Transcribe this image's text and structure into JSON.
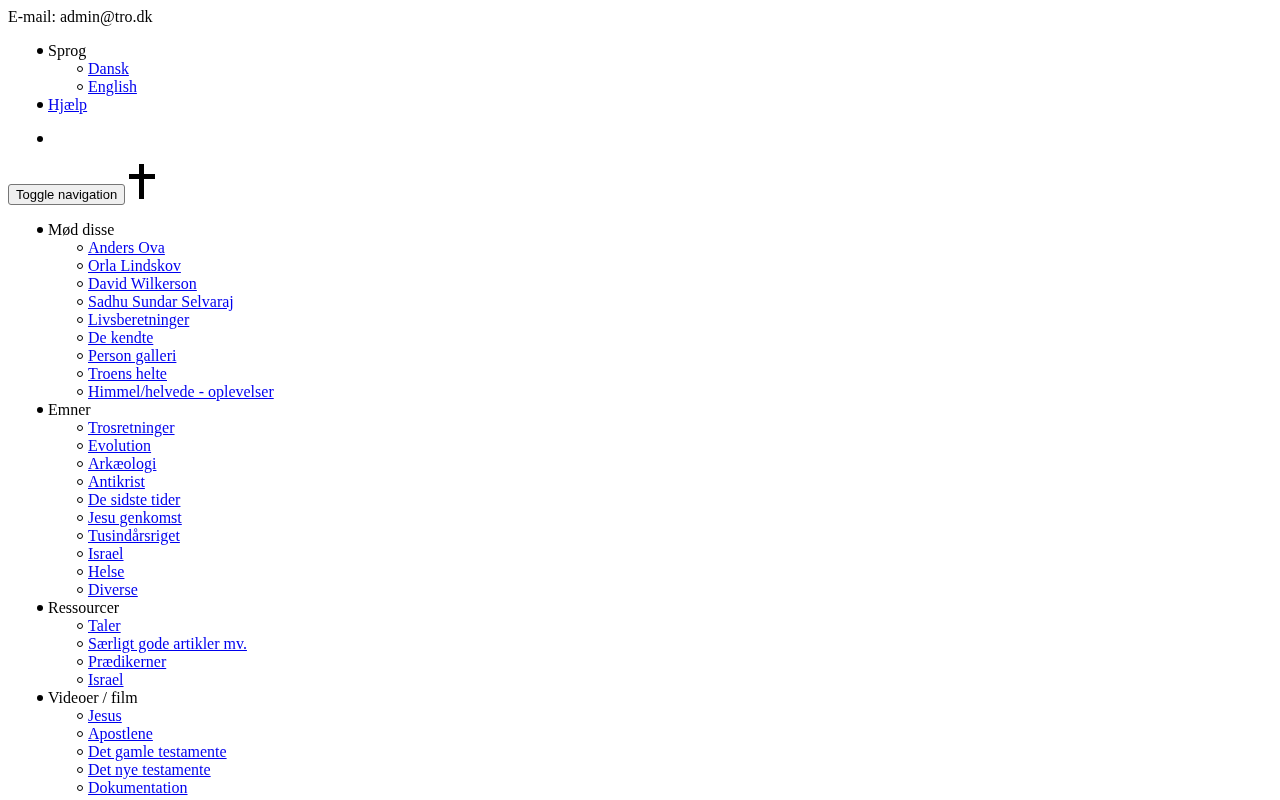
{
  "contact": {
    "email_line": "E-mail: admin@tro.dk"
  },
  "top_menu": [
    {
      "kind": "text",
      "label": "Sprog",
      "children": [
        {
          "label": "Dansk"
        },
        {
          "label": "English"
        }
      ]
    },
    {
      "kind": "link",
      "label": "Hjælp"
    },
    {
      "kind": "empty"
    }
  ],
  "navbar": {
    "toggle_button": "Toggle navigation"
  },
  "main_menu": [
    {
      "label": "Mød disse",
      "children": [
        {
          "label": "Anders Ova"
        },
        {
          "label": "Orla Lindskov"
        },
        {
          "label": "David Wilkerson"
        },
        {
          "label": "Sadhu Sundar Selvaraj"
        },
        {
          "label": "Livsberetninger"
        },
        {
          "label": "De kendte"
        },
        {
          "label": "Person galleri"
        },
        {
          "label": "Troens helte"
        },
        {
          "label": "Himmel/helvede - oplevelser"
        }
      ]
    },
    {
      "label": "Emner",
      "children": [
        {
          "label": "Trosretninger"
        },
        {
          "label": "Evolution"
        },
        {
          "label": "Arkæologi"
        },
        {
          "label": "Antikrist"
        },
        {
          "label": "De sidste tider"
        },
        {
          "label": "Jesu genkomst"
        },
        {
          "label": "Tusindårsriget"
        },
        {
          "label": "Israel"
        },
        {
          "label": "Helse"
        },
        {
          "label": "Diverse"
        }
      ]
    },
    {
      "label": "Ressourcer",
      "children": [
        {
          "label": "Taler"
        },
        {
          "label": "Særligt gode artikler mv."
        },
        {
          "label": "Prædikerner"
        },
        {
          "label": "Israel"
        }
      ]
    },
    {
      "label": "Videoer / film",
      "children": [
        {
          "label": "Jesus"
        },
        {
          "label": "Apostlene"
        },
        {
          "label": "Det gamle testamente"
        },
        {
          "label": "Det nye testamente"
        },
        {
          "label": "Dokumentation"
        }
      ]
    }
  ]
}
